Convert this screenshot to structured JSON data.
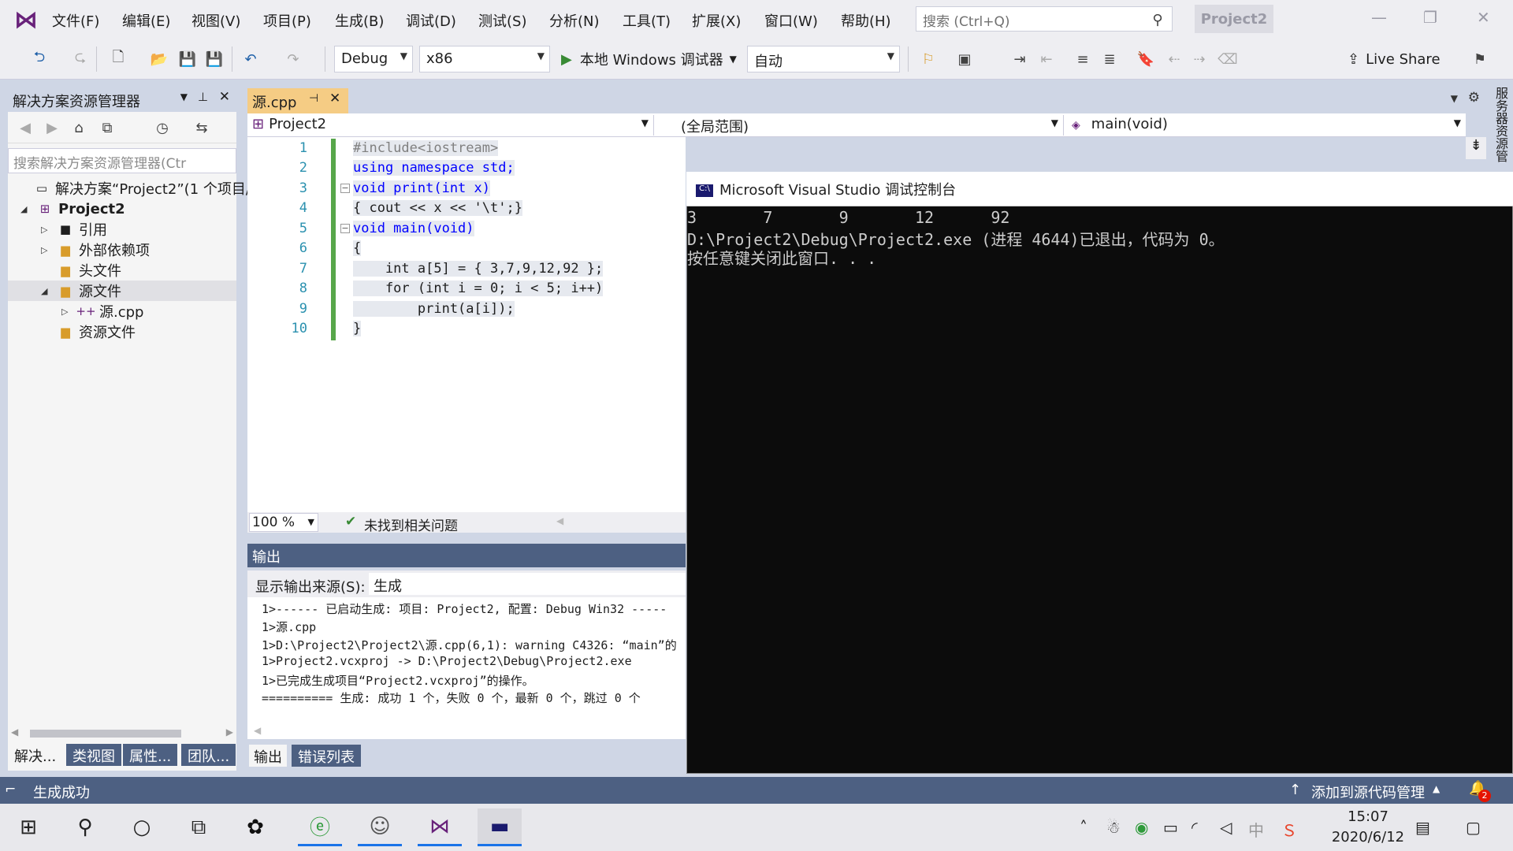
{
  "menubar": {
    "items": [
      "文件(F)",
      "编辑(E)",
      "视图(V)",
      "项目(P)",
      "生成(B)",
      "调试(D)",
      "测试(S)",
      "分析(N)",
      "工具(T)",
      "扩展(X)",
      "窗口(W)",
      "帮助(H)"
    ],
    "search_placeholder": "搜索 (Ctrl+Q)",
    "project_title": "Project2"
  },
  "toolbar": {
    "config": "Debug",
    "platform": "x86",
    "run_label": "本地 Windows 调试器",
    "auto": "自动",
    "live_share": "Live Share"
  },
  "solution": {
    "title": "解决方案资源管理器",
    "search_placeholder": "搜索解决方案资源管理器(Ctr",
    "tree": [
      {
        "label": "解决方案“Project2”(1 个项目/"
      },
      {
        "label": "Project2"
      },
      {
        "label": "引用"
      },
      {
        "label": "外部依赖项"
      },
      {
        "label": "头文件"
      },
      {
        "label": "源文件"
      },
      {
        "label": "源.cpp"
      },
      {
        "label": "资源文件"
      }
    ],
    "bottom_tabs": [
      "解决...",
      "类视图",
      "属性...",
      "团队..."
    ]
  },
  "editor": {
    "tab": "源.cpp",
    "nav_project": "Project2",
    "nav_scope": "(全局范围)",
    "nav_member": "main(void)",
    "line_numbers": [
      "1",
      "2",
      "3",
      "4",
      "5",
      "6",
      "7",
      "8",
      "9",
      "10"
    ],
    "lines": [
      "#include<iostream>",
      "using namespace std;",
      "void print(int x)",
      "{ cout << x << '\\t';}",
      "void main(void)",
      "{",
      "    int a[5] = { 3,7,9,12,92 };",
      "    for (int i = 0; i < 5; i++)",
      "        print(a[i]);",
      "}"
    ],
    "zoom": "100 %",
    "issues": "未找到相关问题"
  },
  "output": {
    "title": "输出",
    "source_label": "显示输出来源(S):",
    "source_value": "生成",
    "lines": [
      "1>------ 已启动生成: 项目: Project2, 配置: Debug Win32 -----",
      "1>源.cpp",
      "1>D:\\Project2\\Project2\\源.cpp(6,1): warning C4326: “main”的",
      "1>Project2.vcxproj -> D:\\Project2\\Debug\\Project2.exe",
      "1>已完成生成项目“Project2.vcxproj”的操作。",
      "========== 生成: 成功 1 个，失败 0 个，最新 0 个，跳过 0 个"
    ],
    "tabs": [
      "输出",
      "错误列表"
    ]
  },
  "console": {
    "title": "Microsoft Visual Studio 调试控制台",
    "lines": [
      "3       7       9       12      92",
      "D:\\Project2\\Debug\\Project2.exe (进程 4644)已退出，代码为 0。",
      "按任意键关闭此窗口. . ."
    ]
  },
  "rightstrip": {
    "label": "服务器资源管"
  },
  "status": {
    "left": "生成成功",
    "right": "添加到源代码管理",
    "badge": "2"
  },
  "taskbar": {
    "time": "15:07",
    "date": "2020/6/12",
    "ime": "中"
  },
  "colors": {
    "accent": "#4d6082",
    "tab_active": "#f5cc84",
    "keyword": "#0000ff",
    "comment_green": "#57a64a",
    "vs_purple": "#68217a"
  }
}
